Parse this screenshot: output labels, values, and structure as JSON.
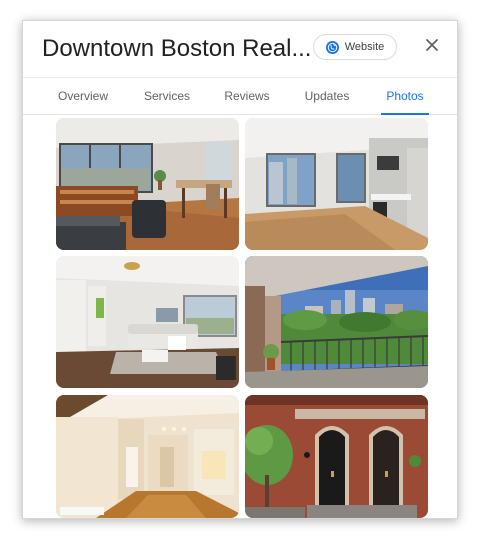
{
  "header": {
    "title": "Downtown Boston Real...",
    "website_label": "Website",
    "close_icon": "close-icon",
    "globe_icon": "globe-icon"
  },
  "tabs": [
    {
      "label": "Overview",
      "active": false
    },
    {
      "label": "Services",
      "active": false
    },
    {
      "label": "Reviews",
      "active": false
    },
    {
      "label": "Updates",
      "active": false
    },
    {
      "label": "Photos",
      "active": true
    }
  ],
  "colors": {
    "accent": "#1a73e8",
    "title_text": "#202124",
    "tab_text": "#5f6368"
  },
  "photos": [
    {
      "subject": "living-room-with-city-view"
    },
    {
      "subject": "kitchen-with-city-view"
    },
    {
      "subject": "living-room-white-sofa"
    },
    {
      "subject": "balcony-overlooking-park"
    },
    {
      "subject": "empty-hallway-rooms"
    },
    {
      "subject": "brick-building-facade"
    }
  ]
}
